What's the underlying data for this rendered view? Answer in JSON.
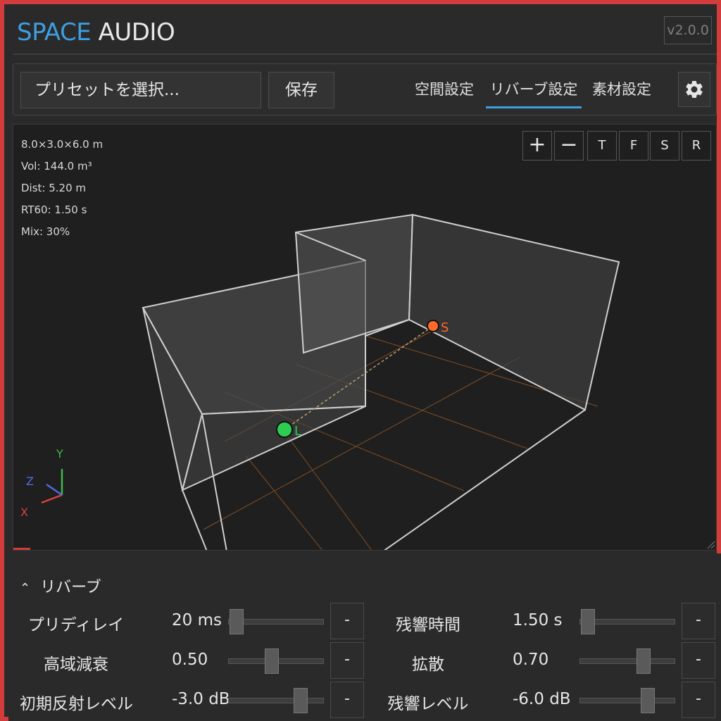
{
  "app": {
    "brand_accent": "SPACE",
    "brand_rest": " AUDIO",
    "version": "v2.0.0"
  },
  "toolbar": {
    "preset_placeholder": "プリセットを選択...",
    "save_label": "保存",
    "tabs": [
      {
        "label": "空間設定",
        "active": false
      },
      {
        "label": "リバーブ設定",
        "active": true
      },
      {
        "label": "素材設定",
        "active": false
      }
    ],
    "settings_icon": "gear-icon"
  },
  "viewport": {
    "stats": [
      "8.0×3.0×6.0 m",
      "Vol: 144.0 m³",
      "Dist: 5.20 m",
      "RT60: 1.50 s",
      "Mix: 30%"
    ],
    "zoom_in": "+",
    "zoom_out": "−",
    "views": [
      "T",
      "F",
      "S",
      "R"
    ],
    "source_label": "S",
    "listener_label": "L",
    "axes": {
      "x": "X",
      "y": "Y",
      "z": "Z"
    },
    "colors": {
      "source": "#ff6a2a",
      "listener": "#2ecc52",
      "grid": "#8a5426",
      "axis_x": "#e04040",
      "axis_y": "#3dbb4a",
      "axis_z": "#4f6de0"
    }
  },
  "reverb": {
    "section_title": "リバーブ",
    "params": [
      {
        "label": "プリディレイ",
        "value": "20 ms",
        "level": 0.02,
        "button": "-"
      },
      {
        "label": "残響時間",
        "value": "1.50 s",
        "level": 0.02,
        "button": "-"
      },
      {
        "label": "高域減衰",
        "value": "0.50",
        "level": 0.45,
        "button": "-"
      },
      {
        "label": "拡散",
        "value": "0.70",
        "level": 0.7,
        "button": "-"
      },
      {
        "label": "初期反射レベル",
        "value": "-3.0 dB",
        "level": 0.8,
        "button": "-"
      },
      {
        "label": "残響レベル",
        "value": "-6.0 dB",
        "level": 0.75,
        "button": "-"
      }
    ]
  },
  "theme": {
    "accent": "#3d9ee0",
    "border": "#d23c3c"
  }
}
